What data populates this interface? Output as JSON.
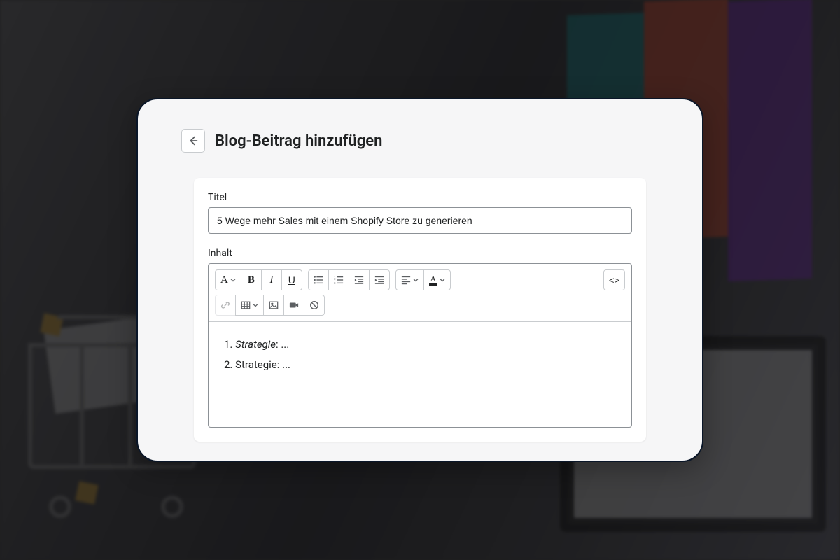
{
  "header": {
    "title": "Blog-Beitrag hinzufügen"
  },
  "form": {
    "title_label": "Titel",
    "title_value": "5 Wege mehr Sales mit einem Shopify Store zu generieren",
    "content_label": "Inhalt"
  },
  "toolbar": {
    "font_format": "A",
    "bold": "B",
    "italic": "I",
    "underline": "U",
    "text_color": "A",
    "html_view": "<>"
  },
  "content": {
    "line1_prefix": "1. ",
    "line1_em": "Strategie",
    "line1_suffix": ": ...",
    "line2": "2. Strategie: ..."
  }
}
